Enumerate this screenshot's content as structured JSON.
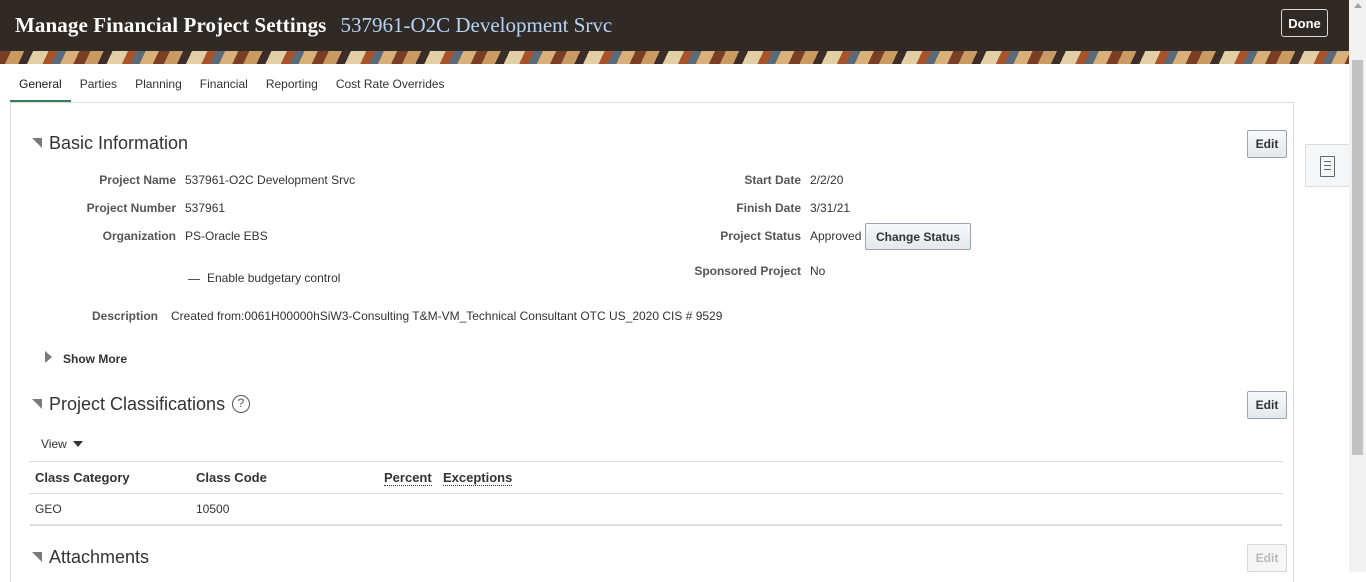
{
  "header": {
    "title": "Manage Financial Project Settings",
    "subtitle": "537961-O2C Development Srvc",
    "done_label": "Done"
  },
  "tabs": [
    {
      "label": "General",
      "active": true
    },
    {
      "label": "Parties",
      "active": false
    },
    {
      "label": "Planning",
      "active": false
    },
    {
      "label": "Financial",
      "active": false
    },
    {
      "label": "Reporting",
      "active": false
    },
    {
      "label": "Cost Rate Overrides",
      "active": false
    }
  ],
  "basic_info": {
    "title": "Basic Information",
    "edit_label": "Edit",
    "project_name_label": "Project Name",
    "project_name": "537961-O2C Development Srvc",
    "project_number_label": "Project Number",
    "project_number": "537961",
    "organization_label": "Organization",
    "organization": "PS-Oracle EBS",
    "budgetary_control_label": "Enable budgetary control",
    "start_date_label": "Start Date",
    "start_date": "2/2/20",
    "finish_date_label": "Finish Date",
    "finish_date": "3/31/21",
    "project_status_label": "Project Status",
    "project_status": "Approved",
    "change_status_label": "Change Status",
    "sponsored_label": "Sponsored Project",
    "sponsored": "No",
    "description_label": "Description",
    "description": "Created from:0061H00000hSiW3-Consulting T&M-VM_Technical Consultant OTC US_2020 CIS # 9529",
    "show_more_label": "Show More"
  },
  "classifications": {
    "title": "Project Classifications",
    "help_glyph": "?",
    "edit_label": "Edit",
    "view_label": "View",
    "columns": [
      "Class Category",
      "Class Code",
      "Percent",
      "Exceptions"
    ],
    "rows": [
      {
        "class_category": "GEO",
        "class_code": "10500",
        "percent": "",
        "exceptions": ""
      }
    ]
  },
  "attachments": {
    "title": "Attachments",
    "edit_label": "Edit"
  },
  "icons": {
    "done": "done-button",
    "side_panel": "document-icon",
    "section_toggle": "collapse-triangle-icon",
    "show_more": "expand-triangle-icon",
    "help": "help-icon",
    "view_menu": "caret-down-icon"
  },
  "colors": {
    "header_bg": "#2f2a26",
    "subtitle": "#b9d4f2",
    "active_tab_underline": "#3a7a5a"
  }
}
